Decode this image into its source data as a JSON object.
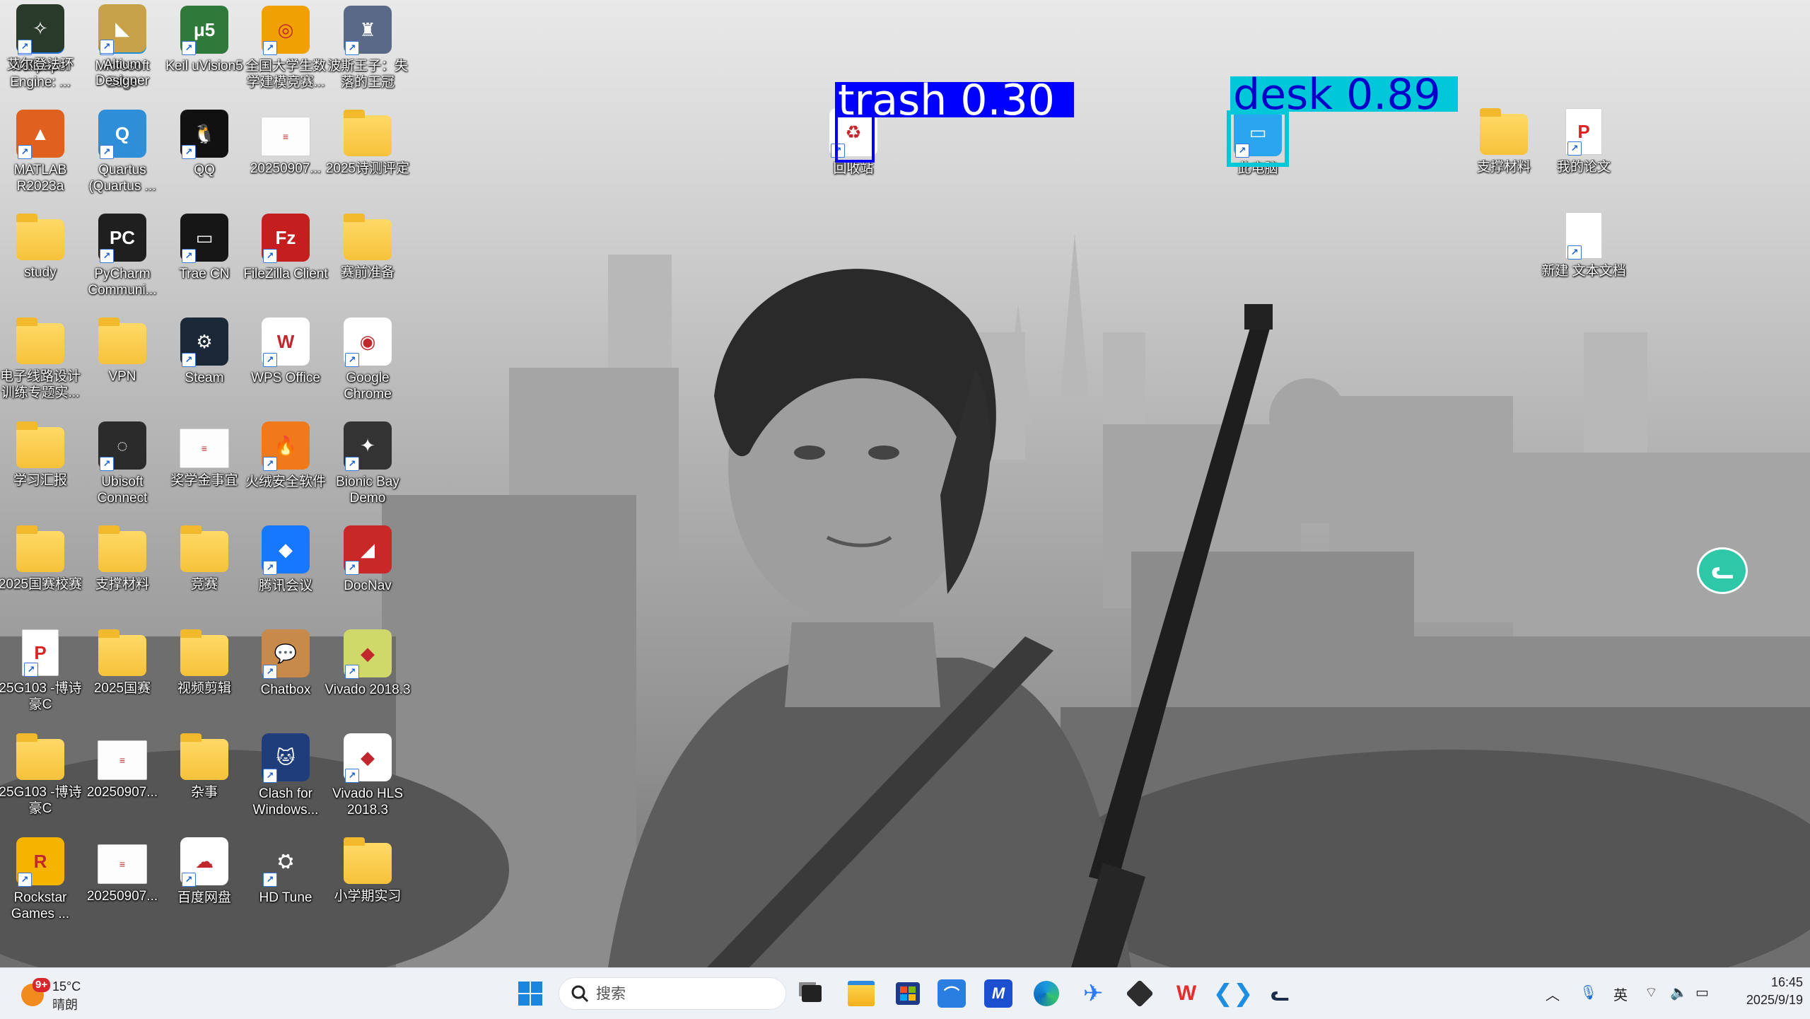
{
  "desktop": {
    "icons": [
      {
        "label": "Wallpaper Engine: ...",
        "kind": "app",
        "color": "#1f6fd6",
        "glyph": "⚙"
      },
      {
        "label": "Microsoft Edge",
        "kind": "app",
        "color": "#1c8ed6",
        "glyph": "e"
      },
      {
        "label": "Keil uVision5",
        "kind": "app",
        "color": "#2f7a3a",
        "glyph": "μ5"
      },
      {
        "label": "全国大学生数学建模竞赛...",
        "kind": "app",
        "color": "#f0a000",
        "glyph": "◎"
      },
      {
        "label": "波斯王子：失落的王冠",
        "kind": "app",
        "color": "#5a6a86",
        "glyph": "♜"
      },
      {
        "label": "MATLAB R2023a",
        "kind": "app",
        "color": "#e06020",
        "glyph": "▲"
      },
      {
        "label": "Quartus (Quartus ...",
        "kind": "app",
        "color": "#2e8fd8",
        "glyph": "Q"
      },
      {
        "label": "QQ",
        "kind": "app",
        "color": "#111111",
        "glyph": "🐧"
      },
      {
        "label": "20250907...",
        "kind": "doc",
        "color": "#ffffff",
        "glyph": "≡"
      },
      {
        "label": "2025诗测评定",
        "kind": "folder",
        "color": "#f6c23a",
        "glyph": ""
      },
      {
        "label": "study",
        "kind": "folder",
        "color": "#f6c23a",
        "glyph": ""
      },
      {
        "label": "PyCharm Communi...",
        "kind": "app",
        "color": "#1f1f1f",
        "glyph": "PC"
      },
      {
        "label": "Trae CN",
        "kind": "app",
        "color": "#161616",
        "glyph": "▭"
      },
      {
        "label": "FileZilla Client",
        "kind": "app",
        "color": "#c41e1e",
        "glyph": "Fz"
      },
      {
        "label": "赛前准备",
        "kind": "folder",
        "color": "#f6c23a",
        "glyph": ""
      },
      {
        "label": "电子线路设计训练专题实...",
        "kind": "folder",
        "color": "#f6c23a",
        "glyph": ""
      },
      {
        "label": "VPN",
        "kind": "folder",
        "color": "#f6c23a",
        "glyph": ""
      },
      {
        "label": "Steam",
        "kind": "app",
        "color": "#1b2838",
        "glyph": "⚙"
      },
      {
        "label": "WPS Office",
        "kind": "app",
        "color": "#ffffff",
        "glyph": "W"
      },
      {
        "label": "Google Chrome",
        "kind": "app",
        "color": "#ffffff",
        "glyph": "◉"
      },
      {
        "label": "学习汇报",
        "kind": "folder",
        "color": "#f6c23a",
        "glyph": ""
      },
      {
        "label": "Ubisoft Connect",
        "kind": "app",
        "color": "#2b2b2b",
        "glyph": "◌"
      },
      {
        "label": "奖学金事宜",
        "kind": "doc",
        "color": "#ffffff",
        "glyph": "≡"
      },
      {
        "label": "火绒安全软件",
        "kind": "app",
        "color": "#f07a1a",
        "glyph": "🔥"
      },
      {
        "label": "Bionic Bay Demo",
        "kind": "app",
        "color": "#333333",
        "glyph": "✦"
      },
      {
        "label": "2025国赛校赛",
        "kind": "folder",
        "color": "#f6c23a",
        "glyph": ""
      },
      {
        "label": "支撑材料",
        "kind": "folder",
        "color": "#f6c23a",
        "glyph": ""
      },
      {
        "label": "竞赛",
        "kind": "folder",
        "color": "#f6c23a",
        "glyph": ""
      },
      {
        "label": "腾讯会议",
        "kind": "app",
        "color": "#1677ff",
        "glyph": "◆"
      },
      {
        "label": "DocNav",
        "kind": "app",
        "color": "#c82828",
        "glyph": "◢"
      },
      {
        "label": "25G103 -博诗豪C",
        "kind": "paper",
        "color": "#ffffff",
        "glyph": "P"
      },
      {
        "label": "2025国赛",
        "kind": "folder",
        "color": "#f6c23a",
        "glyph": ""
      },
      {
        "label": "视频剪辑",
        "kind": "folder",
        "color": "#f6c23a",
        "glyph": ""
      },
      {
        "label": "Chatbox",
        "kind": "app",
        "color": "#c88a4a",
        "glyph": "💬"
      },
      {
        "label": "Vivado 2018.3",
        "kind": "app",
        "color": "#cfd96a",
        "glyph": "◆"
      },
      {
        "label": "25G103 -博诗豪C",
        "kind": "folder",
        "color": "#f6c23a",
        "glyph": ""
      },
      {
        "label": "20250907...",
        "kind": "doc",
        "color": "#ffffff",
        "glyph": "≡"
      },
      {
        "label": "杂事",
        "kind": "folder",
        "color": "#f6c23a",
        "glyph": ""
      },
      {
        "label": "Clash for Windows...",
        "kind": "app",
        "color": "#1f3d7a",
        "glyph": "🐱"
      },
      {
        "label": "Vivado HLS 2018.3",
        "kind": "app",
        "color": "#ffffff",
        "glyph": "◆"
      },
      {
        "label": "Rockstar Games ...",
        "kind": "app",
        "color": "#f5b400",
        "glyph": "R"
      },
      {
        "label": "20250907...",
        "kind": "doc",
        "color": "#ffffff",
        "glyph": "≡"
      },
      {
        "label": "百度网盘",
        "kind": "app",
        "color": "#ffffff",
        "glyph": "☁"
      },
      {
        "label": "HD Tune",
        "kind": "app",
        "color": "#555555",
        "glyph": "⛭"
      },
      {
        "label": "小学期实习",
        "kind": "folder",
        "color": "#f6c23a",
        "glyph": ""
      },
      {
        "label": "艾尔登法环",
        "kind": "app",
        "color": "#2a3a2a",
        "glyph": "✧"
      },
      {
        "label": "Altium Designer",
        "kind": "app",
        "color": "#c8a24a",
        "glyph": "◣"
      }
    ],
    "right_icons": [
      {
        "label": "回收站",
        "kind": "app",
        "color": "#ffffff",
        "glyph": "♻"
      },
      {
        "label": "此电脑",
        "kind": "app",
        "color": "#29a6ef",
        "glyph": "▭"
      },
      {
        "label": "支撑材料",
        "kind": "folder",
        "color": "#f6c23a",
        "glyph": ""
      },
      {
        "label": "我的论文",
        "kind": "paper",
        "color": "#ffffff",
        "glyph": "P"
      },
      {
        "label": "新建 文本文档",
        "kind": "paper",
        "color": "#ffffff",
        "glyph": ""
      }
    ]
  },
  "detections": [
    {
      "label": "trash 0.30",
      "color": "#0000ff"
    },
    {
      "label": "desk 0.89",
      "color": "#00c8d8"
    }
  ],
  "taskbar": {
    "weather": {
      "temp": "15°C",
      "condition": "晴朗",
      "badge": "9+"
    },
    "search_placeholder": "搜索",
    "pinned": [
      {
        "name": "task-view-icon"
      },
      {
        "name": "file-explorer-icon"
      },
      {
        "name": "microsoft-store-icon"
      },
      {
        "name": "app-blue-icon"
      },
      {
        "name": "app-m-icon"
      },
      {
        "name": "edge-icon"
      },
      {
        "name": "feishu-icon"
      },
      {
        "name": "cube-icon"
      },
      {
        "name": "wps-icon"
      },
      {
        "name": "vscode-icon"
      },
      {
        "name": "clash-icon"
      }
    ],
    "tray": {
      "ime": "英",
      "time": "16:45",
      "date": "2025/9/19"
    }
  }
}
